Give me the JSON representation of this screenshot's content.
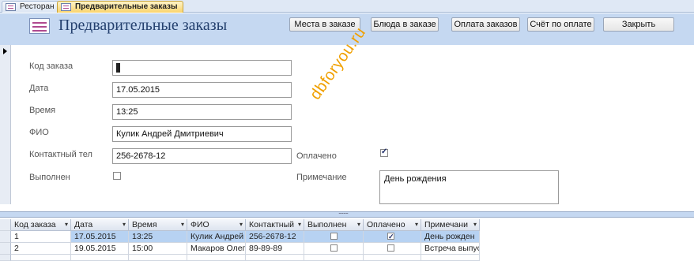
{
  "tabs": [
    {
      "label": "Ресторан",
      "active": false
    },
    {
      "label": "Предварительные заказы",
      "active": true
    }
  ],
  "header": {
    "title": "Предварительные заказы",
    "buttons": [
      "Места в заказе",
      "Блюда в заказе",
      "Оплата заказов",
      "Счёт по оплате",
      "Закрыть"
    ]
  },
  "form": {
    "order_code_label": "Код заказа",
    "date_label": "Дата",
    "date_value": "17.05.2015",
    "time_label": "Время",
    "time_value": "13:25",
    "fio_label": "ФИО",
    "fio_value": "Кулик Андрей Дмитриевич",
    "phone_label": "Контактный тел",
    "phone_value": "256-2678-12",
    "done_label": "Выполнен",
    "done_checked": false,
    "paid_label": "Оплачено",
    "paid_checked": true,
    "note_label": "Примечание",
    "note_value": "День рождения"
  },
  "watermark": "dbforyou.ru",
  "grid": {
    "columns": [
      "Код заказа",
      "Дата",
      "Время",
      "ФИО",
      "Контактный",
      "Выполнен",
      "Оплачено",
      "Примечани"
    ],
    "rows": [
      {
        "code": "1",
        "date": "17.05.2015",
        "time": "13:25",
        "fio": "Кулик Андрей",
        "phone": "256-2678-12",
        "done": false,
        "paid": true,
        "note": "День рожден"
      },
      {
        "code": "2",
        "date": "19.05.2015",
        "time": "15:00",
        "fio": "Макаров Олег",
        "phone": "89-89-89",
        "done": false,
        "paid": false,
        "note": "Встреча выпус"
      }
    ]
  },
  "colors": {
    "header_bg": "#c5d8f1",
    "title": "#24406e",
    "active_tab": "#f9d36c",
    "selected_row": "#b7d2f2",
    "watermark": "#f0a000"
  }
}
